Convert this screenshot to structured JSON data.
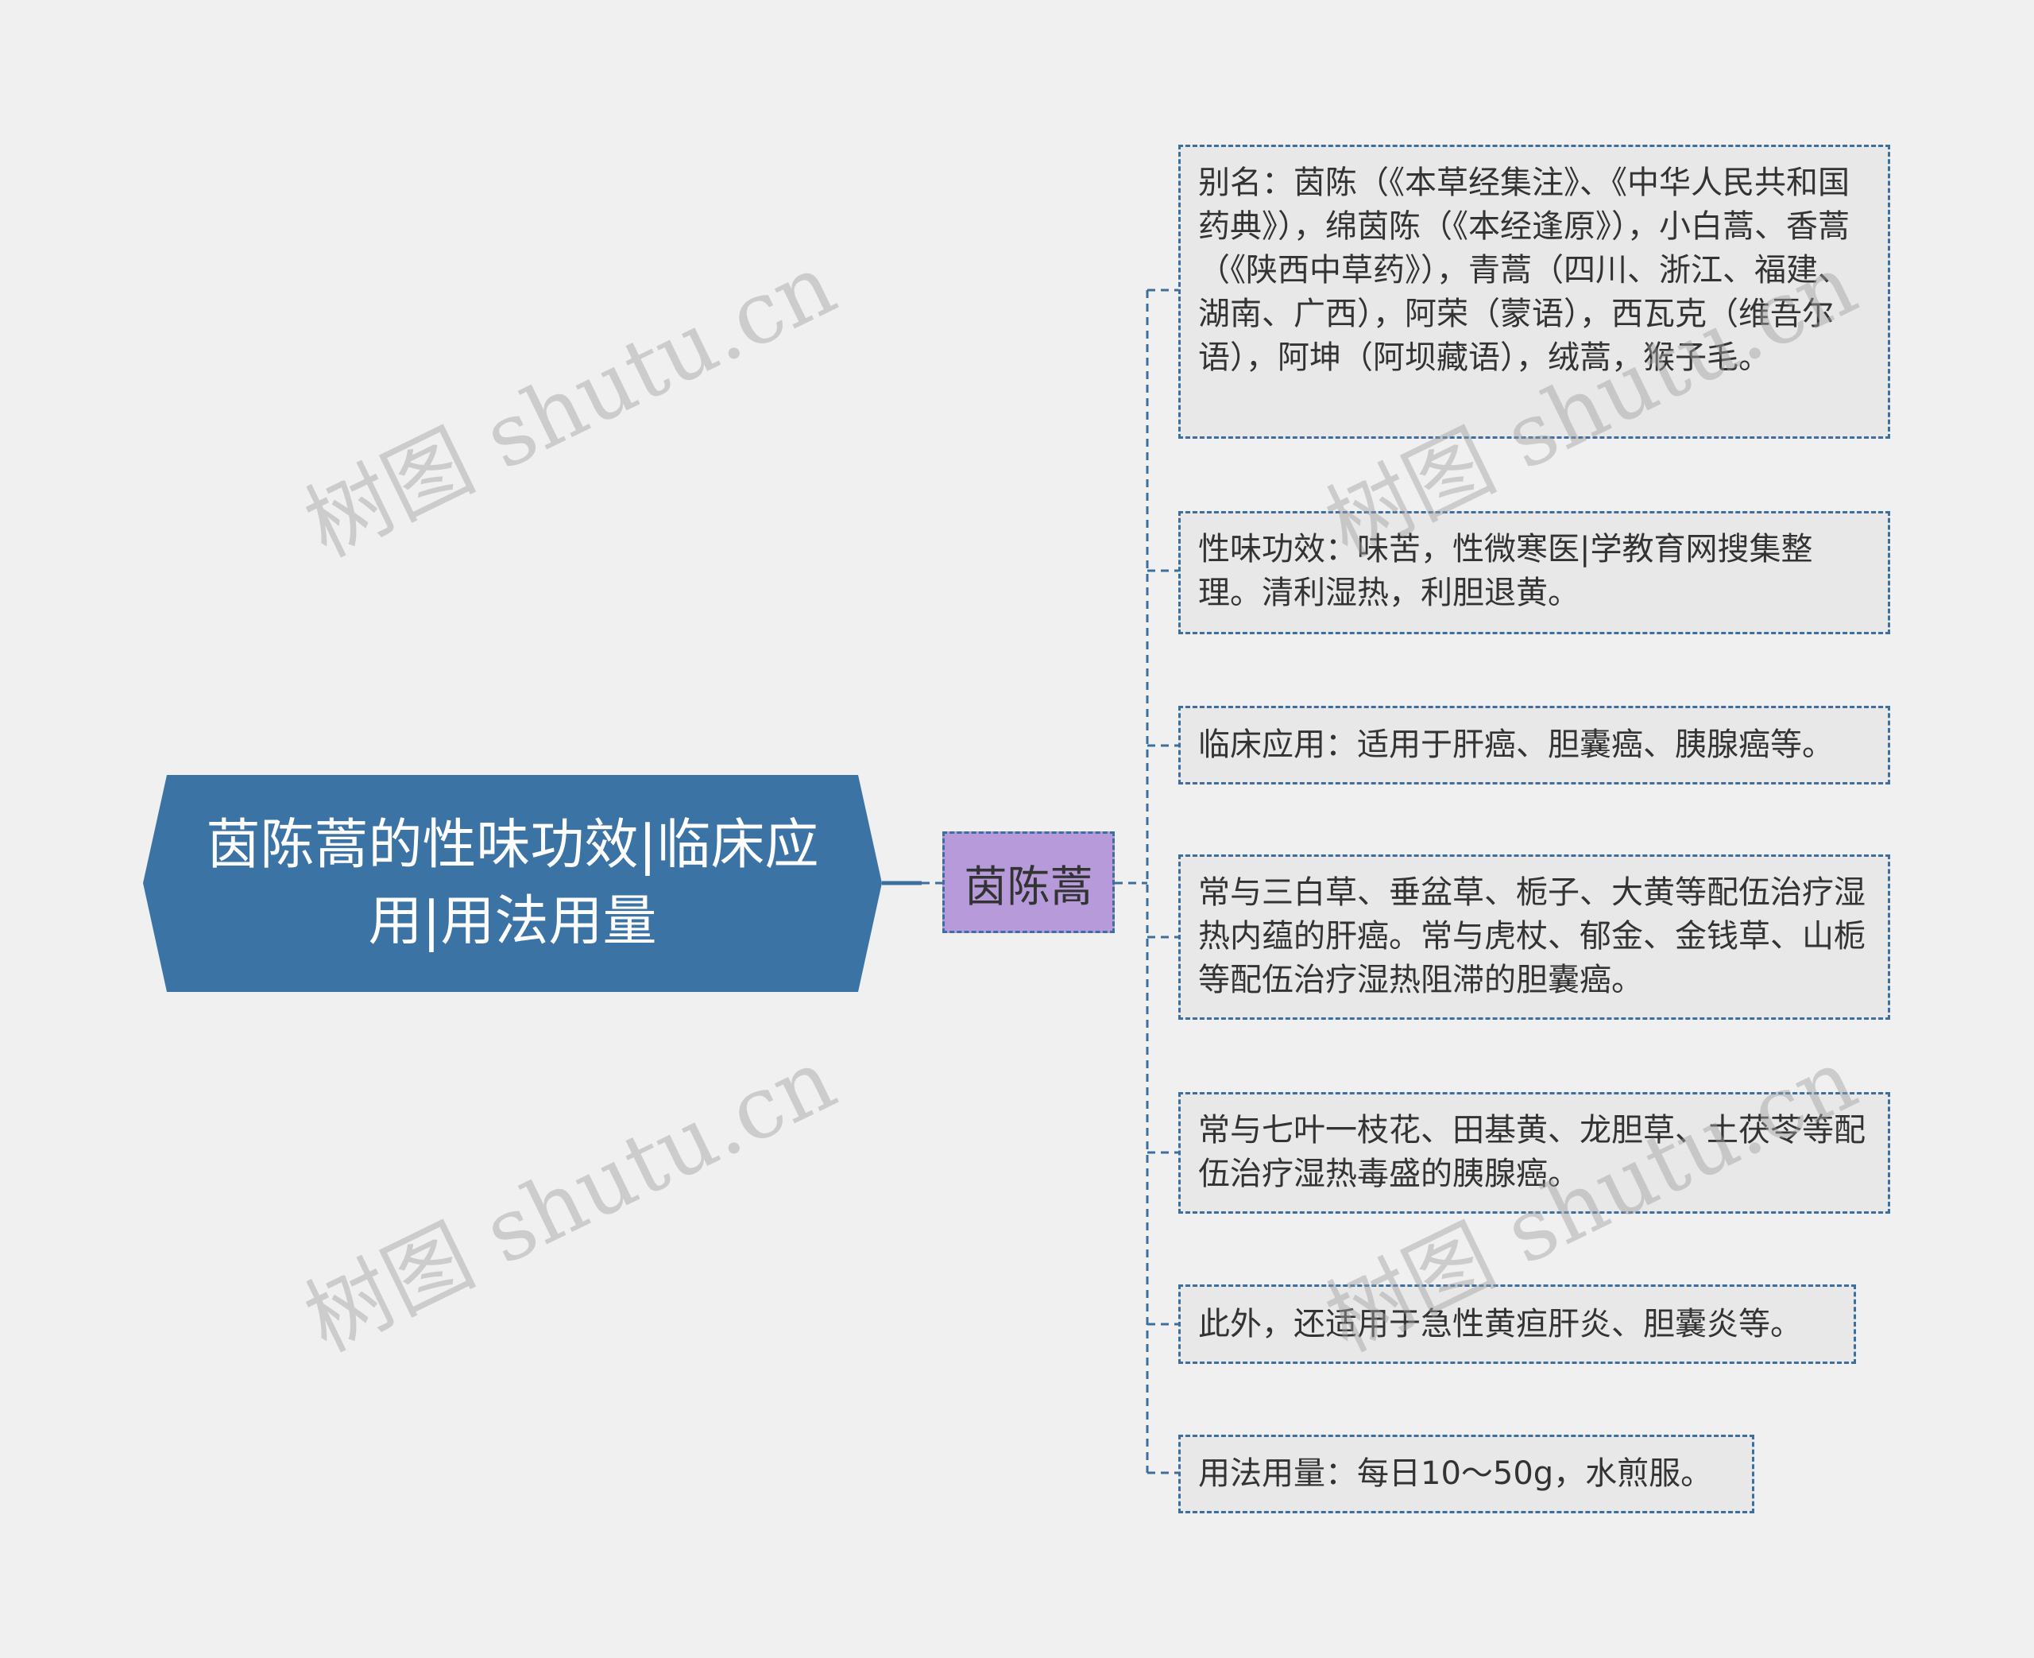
{
  "colors": {
    "background": "#f0f0f0",
    "root_fill": "#3c73a5",
    "mid_fill": "#b79ad9",
    "leaf_fill": "#e8e8e8",
    "connector": "#3c6f9e",
    "text": "#333333"
  },
  "root": {
    "label": "茵陈蒿的性味功效|临床应用|用法用量"
  },
  "topic": {
    "label": "茵陈蒿"
  },
  "leaves": [
    {
      "text": "别名：茵陈（《本草经集注》、《中华人民共和国药典》），绵茵陈（《本经逢原》），小白蒿、香蒿（《陕西中草药》），青蒿（四川、浙江、福建、湖南、广西），阿荣（蒙语），西瓦克（维吾尔语），阿坤（阿坝藏语），绒蒿，猴子毛。"
    },
    {
      "text": "性味功效：味苦，性微寒医|学教育网搜集整理。清利湿热，利胆退黄。"
    },
    {
      "text": "临床应用：适用于肝癌、胆囊癌、胰腺癌等。"
    },
    {
      "text": "常与三白草、垂盆草、栀子、大黄等配伍治疗湿热内蕴的肝癌。常与虎杖、郁金、金钱草、山栀等配伍治疗湿热阻滞的胆囊癌。"
    },
    {
      "text": "常与七叶一枝花、田基黄、龙胆草、土茯苓等配伍治疗湿热毒盛的胰腺癌。"
    },
    {
      "text": "此外，还适用于急性黄疸肝炎、胆囊炎等。"
    },
    {
      "text": "用法用量：每日10～50g，水煎服。"
    }
  ],
  "watermark": {
    "text": "树图 shutu.cn"
  }
}
